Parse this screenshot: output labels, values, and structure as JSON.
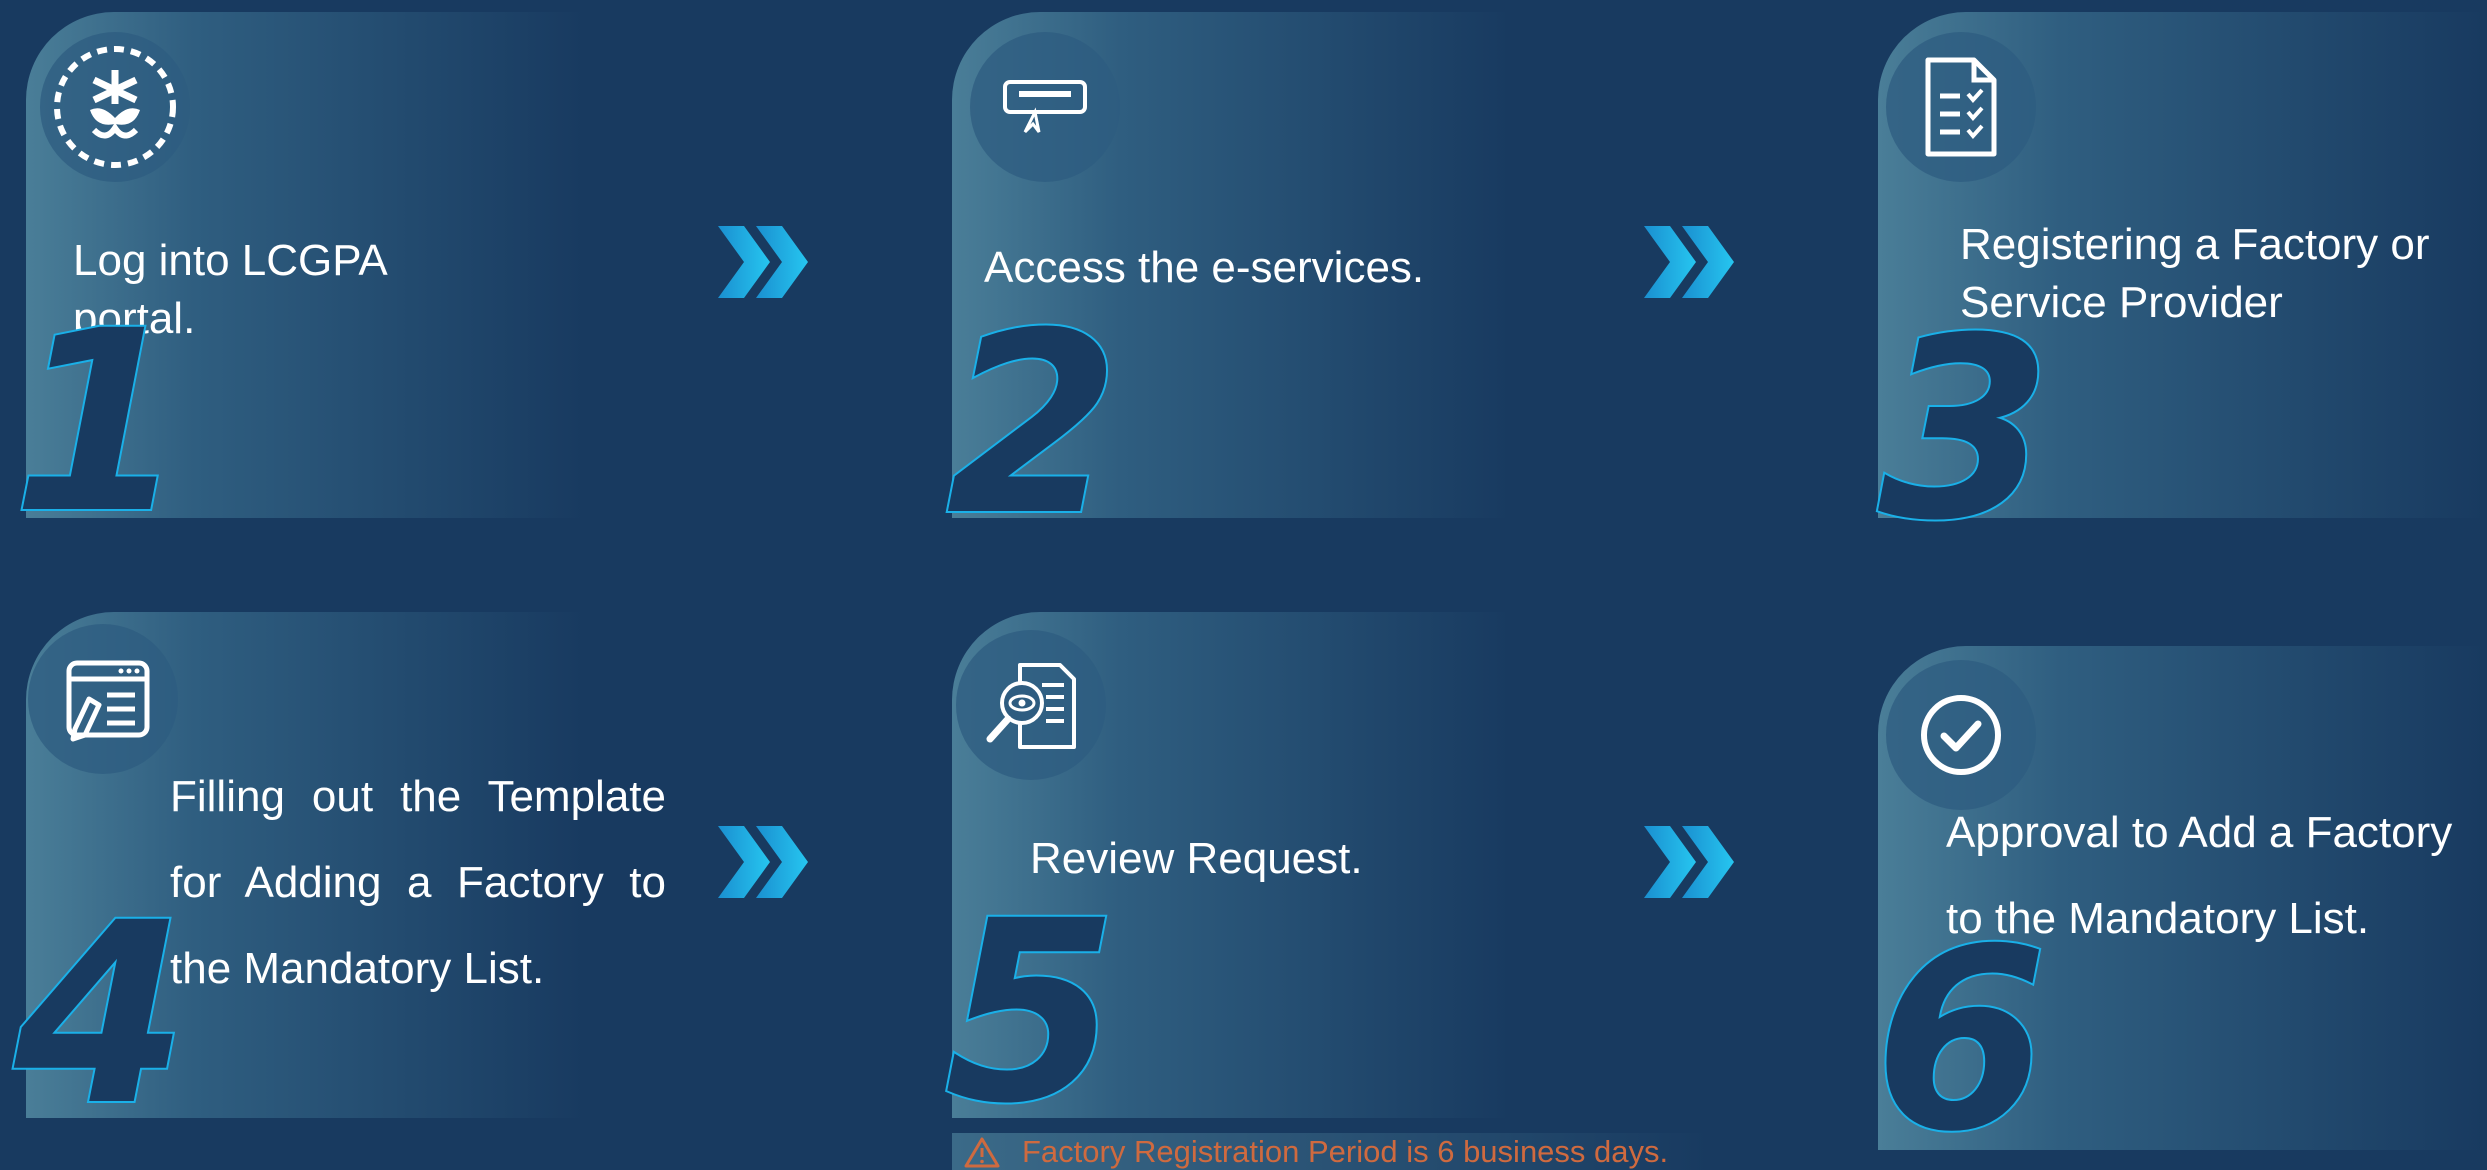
{
  "steps": [
    {
      "number": "1",
      "text": "Log into LCGPA portal.",
      "icon": "lcgpa-logo-icon"
    },
    {
      "number": "2",
      "text": "Access the e-services.",
      "icon": "message-pointer-icon"
    },
    {
      "number": "3",
      "text": "Registering a Factory or Service Provider",
      "icon": "document-checklist-icon"
    },
    {
      "number": "4",
      "text": "Filling out the Template for Adding a Factory to the Mandatory List.",
      "icon": "form-edit-icon"
    },
    {
      "number": "5",
      "text": "Review Request.",
      "icon": "document-search-icon"
    },
    {
      "number": "6",
      "text": "Approval to Add a Factory to the Mandatory List.",
      "icon": "check-circle-icon"
    }
  ],
  "notice": {
    "text": "Factory Registration Period is 6 business days.",
    "icon": "warning-icon"
  },
  "colors": {
    "background": "#183a60",
    "accent": "#1ab0e8",
    "warning": "#cf6a3f"
  }
}
